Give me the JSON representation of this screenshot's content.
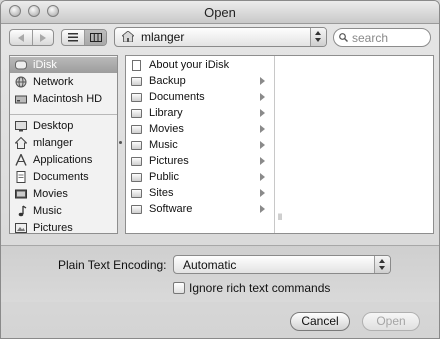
{
  "window": {
    "title": "Open"
  },
  "toolbar": {
    "back_icon": "back-arrow-icon",
    "forward_icon": "forward-arrow-icon",
    "list_view_icon": "list-view-icon",
    "column_view_icon": "column-view-icon",
    "path_popup": {
      "value": "mlanger",
      "icon": "home-folder-icon"
    },
    "search": {
      "placeholder": "search",
      "icon": "search-icon"
    }
  },
  "sidebar": {
    "devices": [
      {
        "label": "iDisk",
        "icon": "idisk-icon",
        "selected": true
      },
      {
        "label": "Network",
        "icon": "network-icon"
      },
      {
        "label": "Macintosh HD",
        "icon": "hard-drive-icon"
      }
    ],
    "places": [
      {
        "label": "Desktop",
        "icon": "desktop-icon"
      },
      {
        "label": "mlanger",
        "icon": "home-icon"
      },
      {
        "label": "Applications",
        "icon": "applications-icon"
      },
      {
        "label": "Documents",
        "icon": "documents-icon"
      },
      {
        "label": "Movies",
        "icon": "movies-icon"
      },
      {
        "label": "Music",
        "icon": "music-icon"
      },
      {
        "label": "Pictures",
        "icon": "pictures-icon"
      }
    ]
  },
  "browser": {
    "items": [
      {
        "label": "About your iDisk",
        "type": "document",
        "has_children": false
      },
      {
        "label": "Backup",
        "type": "folder",
        "has_children": true
      },
      {
        "label": "Documents",
        "type": "folder",
        "has_children": true
      },
      {
        "label": "Library",
        "type": "folder",
        "has_children": true
      },
      {
        "label": "Movies",
        "type": "folder",
        "has_children": true
      },
      {
        "label": "Music",
        "type": "folder",
        "has_children": true
      },
      {
        "label": "Pictures",
        "type": "folder",
        "has_children": true
      },
      {
        "label": "Public",
        "type": "folder",
        "has_children": true
      },
      {
        "label": "Sites",
        "type": "folder",
        "has_children": true
      },
      {
        "label": "Software",
        "type": "folder",
        "has_children": true
      }
    ]
  },
  "options": {
    "encoding_label": "Plain Text Encoding:",
    "encoding_value": "Automatic",
    "ignore_rich_text_label": "Ignore rich text commands",
    "ignore_rich_text_checked": false
  },
  "buttons": {
    "cancel": "Cancel",
    "open": "Open",
    "open_enabled": false
  }
}
